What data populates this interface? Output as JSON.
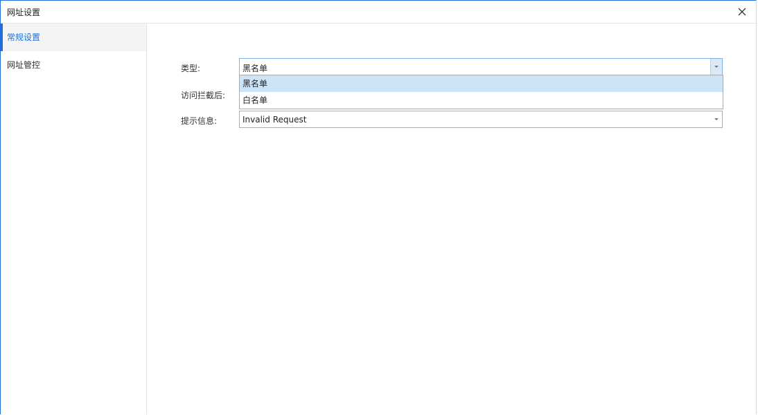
{
  "window": {
    "title": "网址设置",
    "close_icon": "close-icon"
  },
  "sidebar": {
    "items": [
      {
        "label": "常规设置",
        "active": true
      },
      {
        "label": "网址管控",
        "active": false
      }
    ]
  },
  "form": {
    "type_label": "类型:",
    "type_value": "黑名单",
    "type_options": [
      "黑名单",
      "白名单"
    ],
    "type_selected_index": 0,
    "after_block_label": "访问拦截后:",
    "tip_label": "提示信息:",
    "tip_value": "Invalid Request"
  },
  "colors": {
    "accent": "#1e6fd9",
    "selected_option": "#cde3f7",
    "active_nav_bg": "#f4f4f4"
  }
}
